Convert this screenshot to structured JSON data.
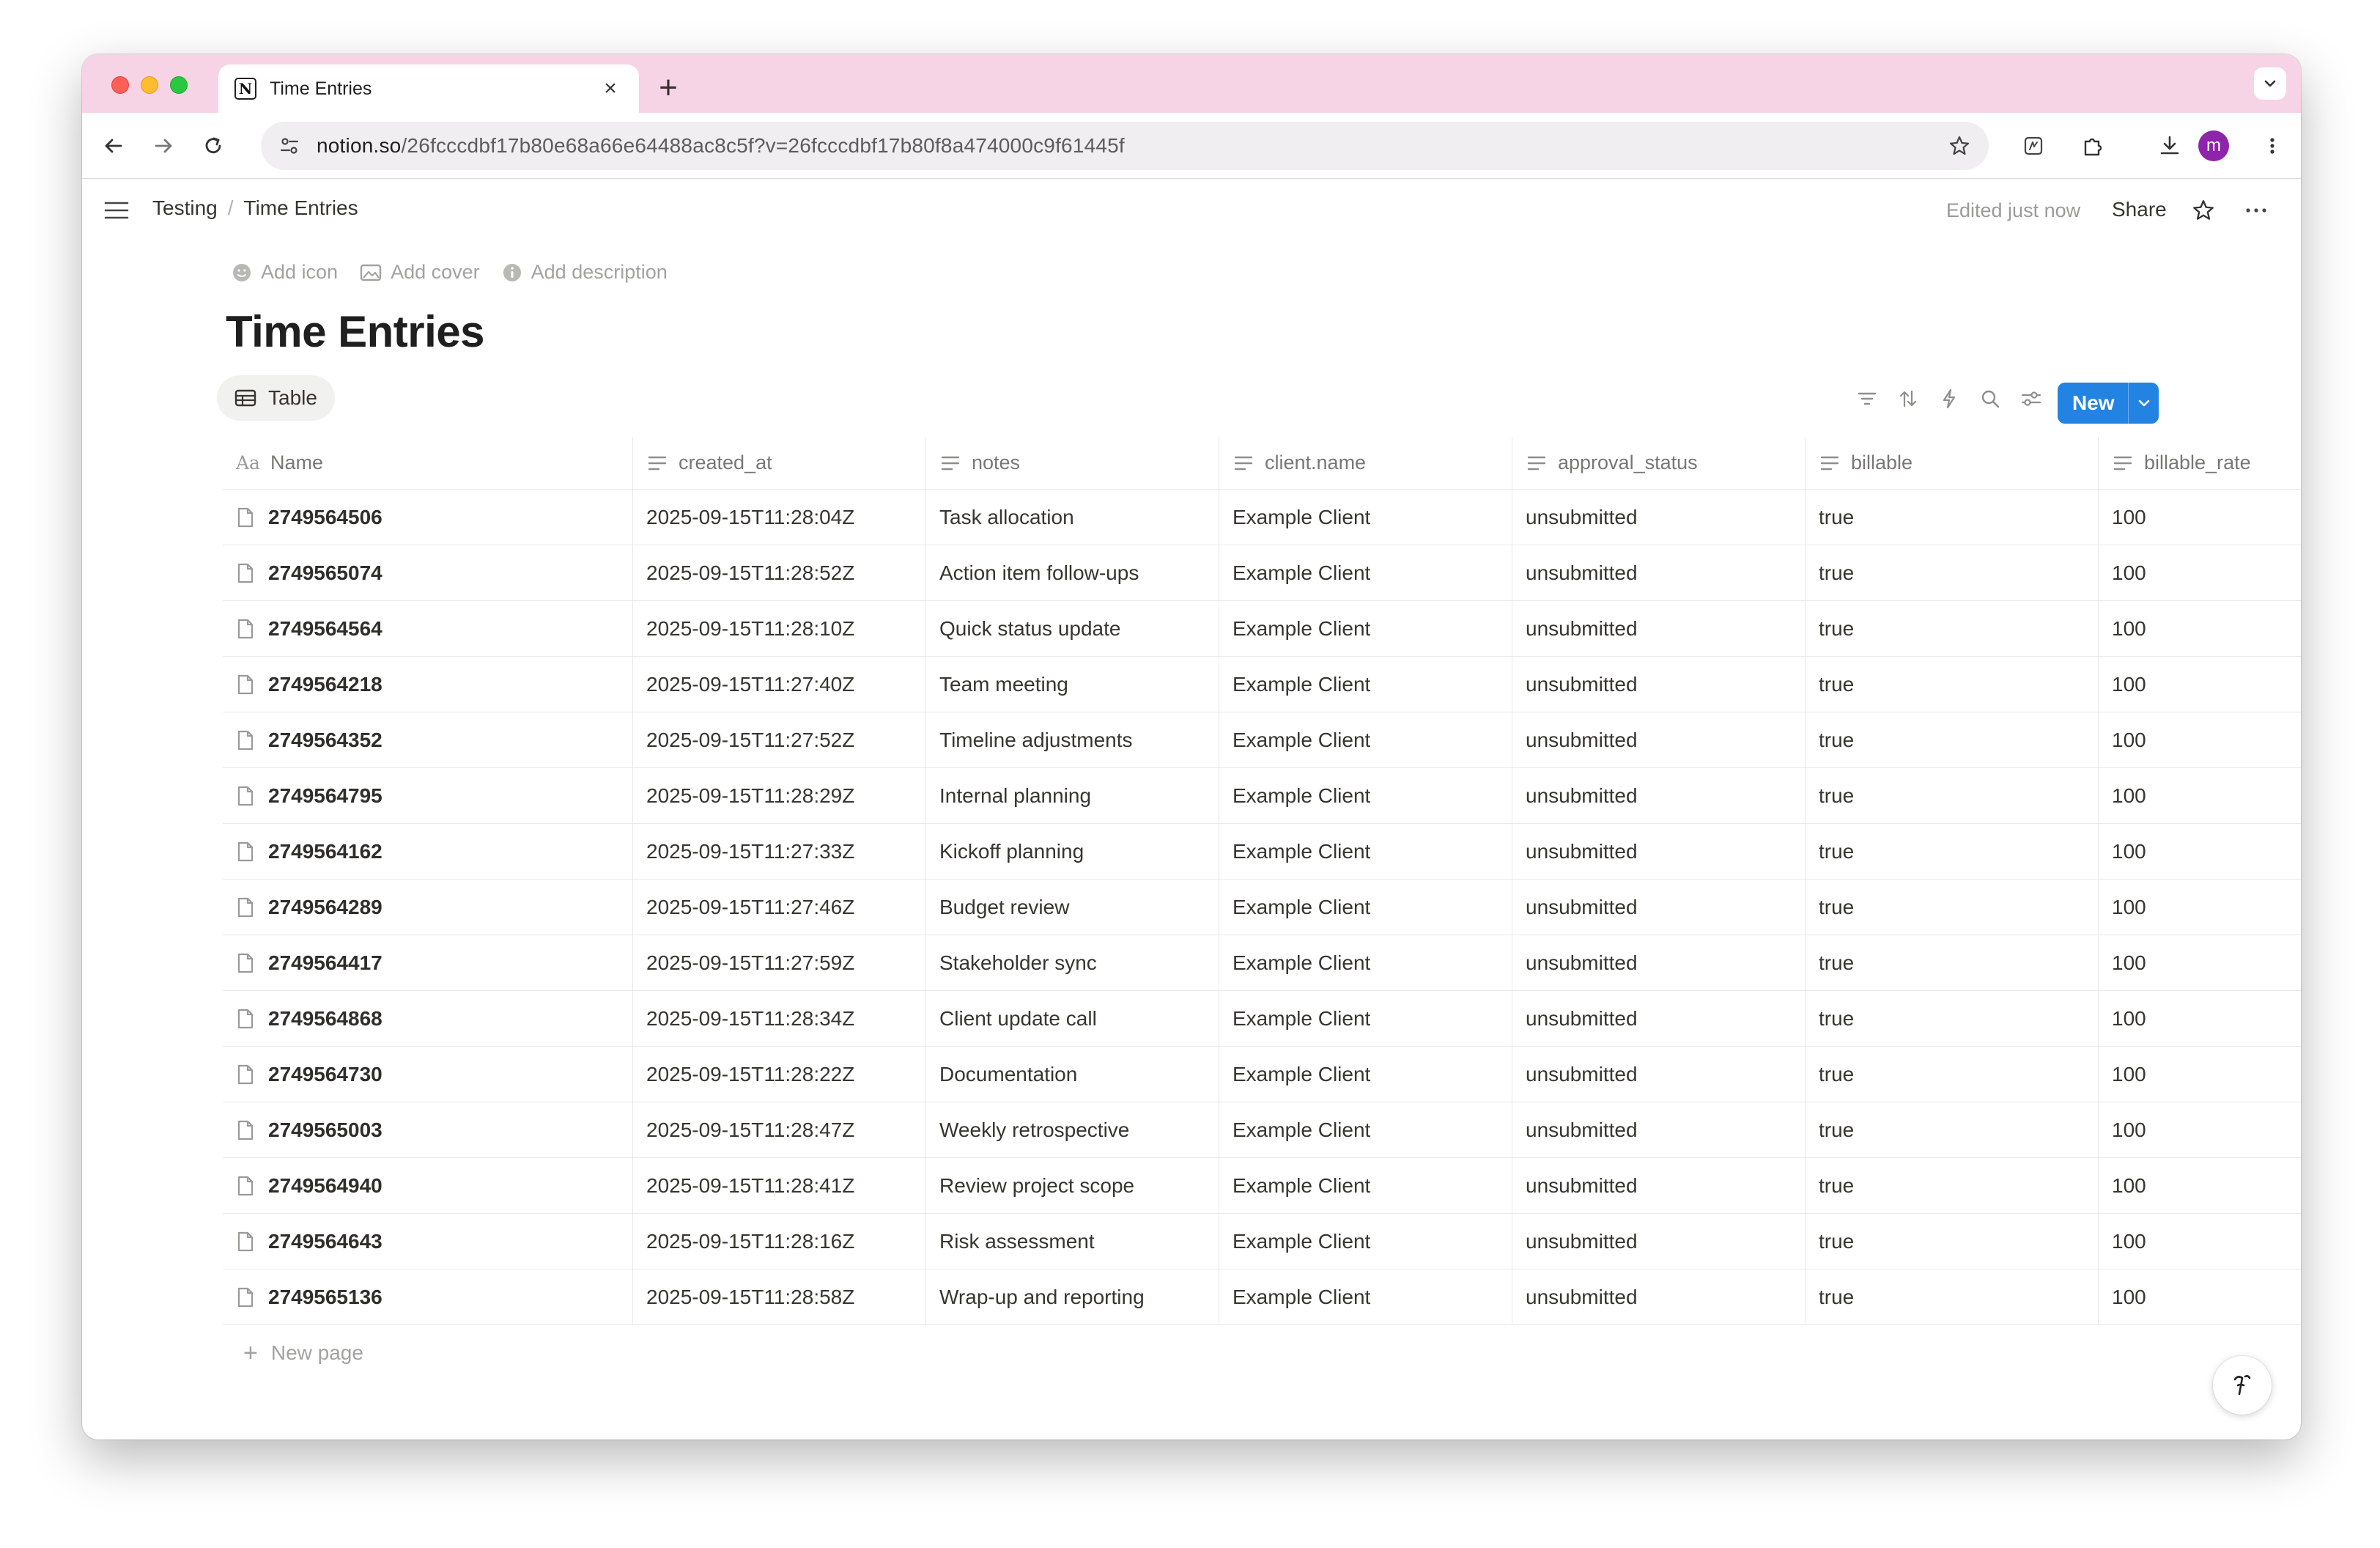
{
  "browser": {
    "tab_title": "Time Entries",
    "url_domain": "notion.so",
    "url_path": "/26fcccdbf17b80e68a66e64488ac8c5f?v=26fcccdbf17b80f8a474000c9f61445f",
    "avatar_letter": "m",
    "avatar_color": "#8e24aa",
    "tab_strip_color": "#f6d3e5"
  },
  "topbar": {
    "breadcrumb": [
      "Testing",
      "Time Entries"
    ],
    "edited_text": "Edited just now",
    "share_label": "Share"
  },
  "page": {
    "actions": {
      "add_icon": "Add icon",
      "add_cover": "Add cover",
      "add_description": "Add description"
    },
    "title": "Time Entries",
    "view_tab": "Table",
    "new_button": "New",
    "new_page": "New page",
    "accent_color": "#2383e2"
  },
  "table": {
    "columns": [
      "Name",
      "created_at",
      "notes",
      "client.name",
      "approval_status",
      "billable",
      "billable_rate"
    ],
    "name_icon_label": "Aa",
    "rows": [
      [
        "2749564506",
        "2025-09-15T11:28:04Z",
        "Task allocation",
        "Example Client",
        "unsubmitted",
        "true",
        "100"
      ],
      [
        "2749565074",
        "2025-09-15T11:28:52Z",
        "Action item follow-ups",
        "Example Client",
        "unsubmitted",
        "true",
        "100"
      ],
      [
        "2749564564",
        "2025-09-15T11:28:10Z",
        "Quick status update",
        "Example Client",
        "unsubmitted",
        "true",
        "100"
      ],
      [
        "2749564218",
        "2025-09-15T11:27:40Z",
        "Team meeting",
        "Example Client",
        "unsubmitted",
        "true",
        "100"
      ],
      [
        "2749564352",
        "2025-09-15T11:27:52Z",
        "Timeline adjustments",
        "Example Client",
        "unsubmitted",
        "true",
        "100"
      ],
      [
        "2749564795",
        "2025-09-15T11:28:29Z",
        "Internal planning",
        "Example Client",
        "unsubmitted",
        "true",
        "100"
      ],
      [
        "2749564162",
        "2025-09-15T11:27:33Z",
        "Kickoff planning",
        "Example Client",
        "unsubmitted",
        "true",
        "100"
      ],
      [
        "2749564289",
        "2025-09-15T11:27:46Z",
        "Budget review",
        "Example Client",
        "unsubmitted",
        "true",
        "100"
      ],
      [
        "2749564417",
        "2025-09-15T11:27:59Z",
        "Stakeholder sync",
        "Example Client",
        "unsubmitted",
        "true",
        "100"
      ],
      [
        "2749564868",
        "2025-09-15T11:28:34Z",
        "Client update call",
        "Example Client",
        "unsubmitted",
        "true",
        "100"
      ],
      [
        "2749564730",
        "2025-09-15T11:28:22Z",
        "Documentation",
        "Example Client",
        "unsubmitted",
        "true",
        "100"
      ],
      [
        "2749565003",
        "2025-09-15T11:28:47Z",
        "Weekly retrospective",
        "Example Client",
        "unsubmitted",
        "true",
        "100"
      ],
      [
        "2749564940",
        "2025-09-15T11:28:41Z",
        "Review project scope",
        "Example Client",
        "unsubmitted",
        "true",
        "100"
      ],
      [
        "2749564643",
        "2025-09-15T11:28:16Z",
        "Risk assessment",
        "Example Client",
        "unsubmitted",
        "true",
        "100"
      ],
      [
        "2749565136",
        "2025-09-15T11:28:58Z",
        "Wrap-up and reporting",
        "Example Client",
        "unsubmitted",
        "true",
        "100"
      ]
    ]
  }
}
